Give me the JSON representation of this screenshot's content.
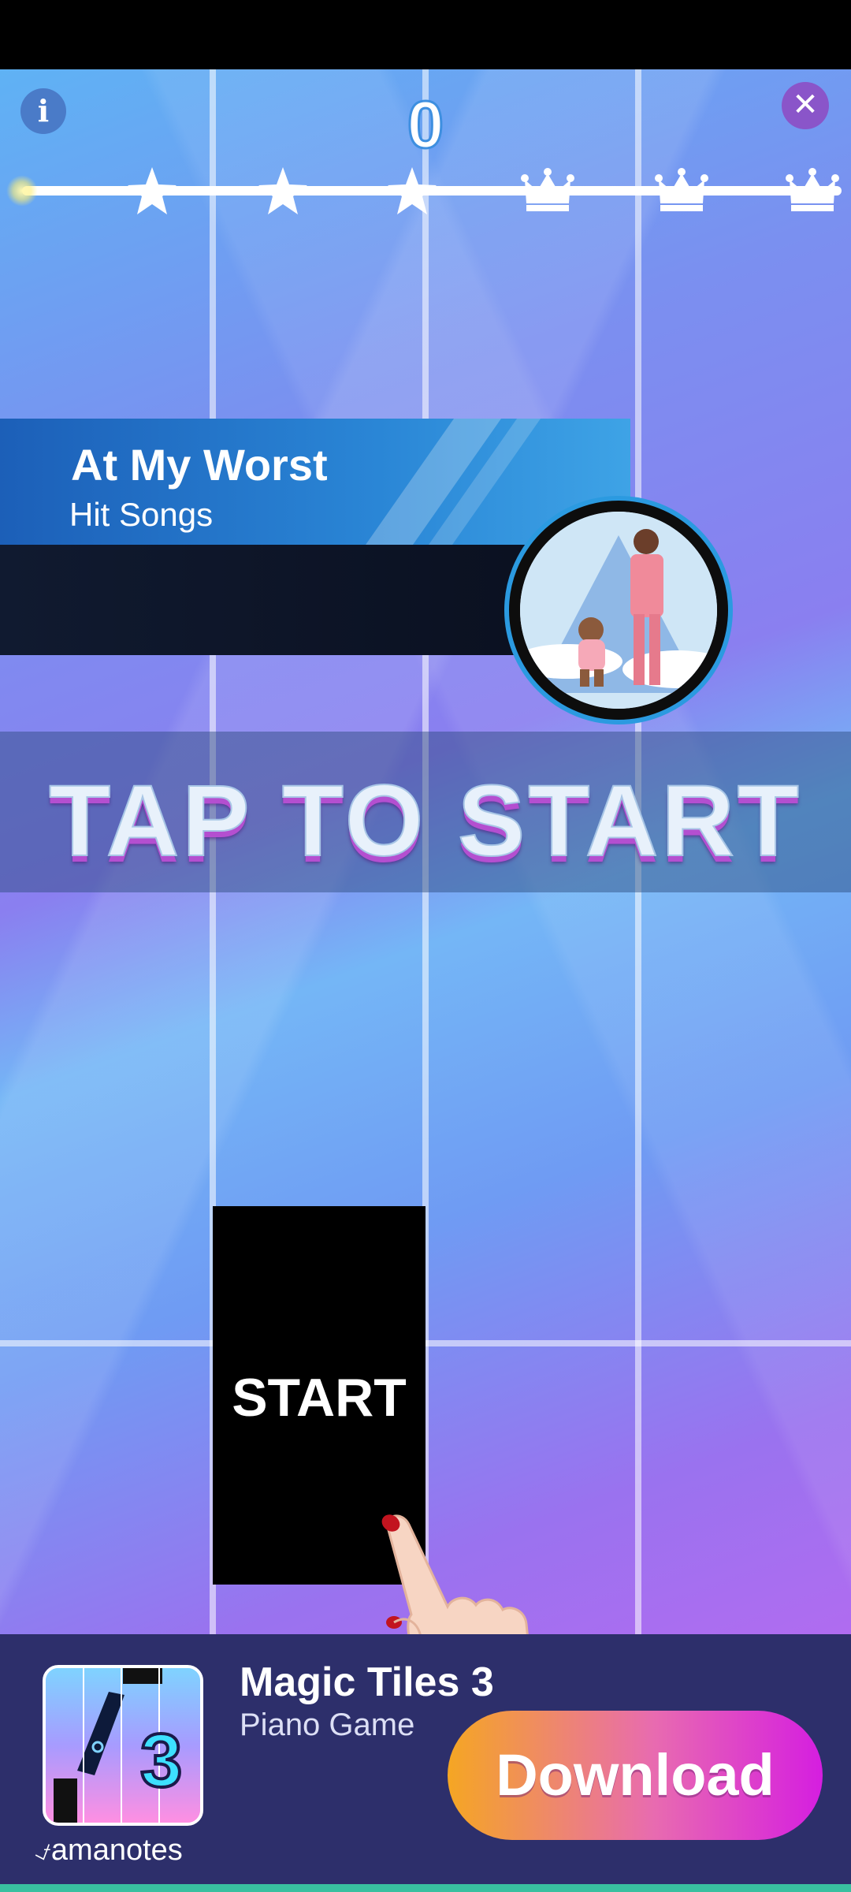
{
  "hud": {
    "info_icon": "i",
    "close_icon": "✕",
    "score": "0",
    "milestones": [
      "star-icon",
      "star-icon",
      "star-icon",
      "crown-icon",
      "crown-icon",
      "crown-icon"
    ]
  },
  "song": {
    "title": "At My Worst",
    "category": "Hit Songs"
  },
  "prompt": {
    "tap_to_start": "TAP TO START",
    "start_tile_label": "START"
  },
  "ad": {
    "app_name": "Magic Tiles 3",
    "app_subtitle": "Piano Game",
    "brand": "amanotes",
    "cta": "Download",
    "icon_number": "3"
  },
  "colors": {
    "accent_blue": "#2b9ae0",
    "ad_background": "#2d2f6b",
    "cta_gradient_start": "#f5a623",
    "cta_gradient_end": "#d51ee0"
  }
}
